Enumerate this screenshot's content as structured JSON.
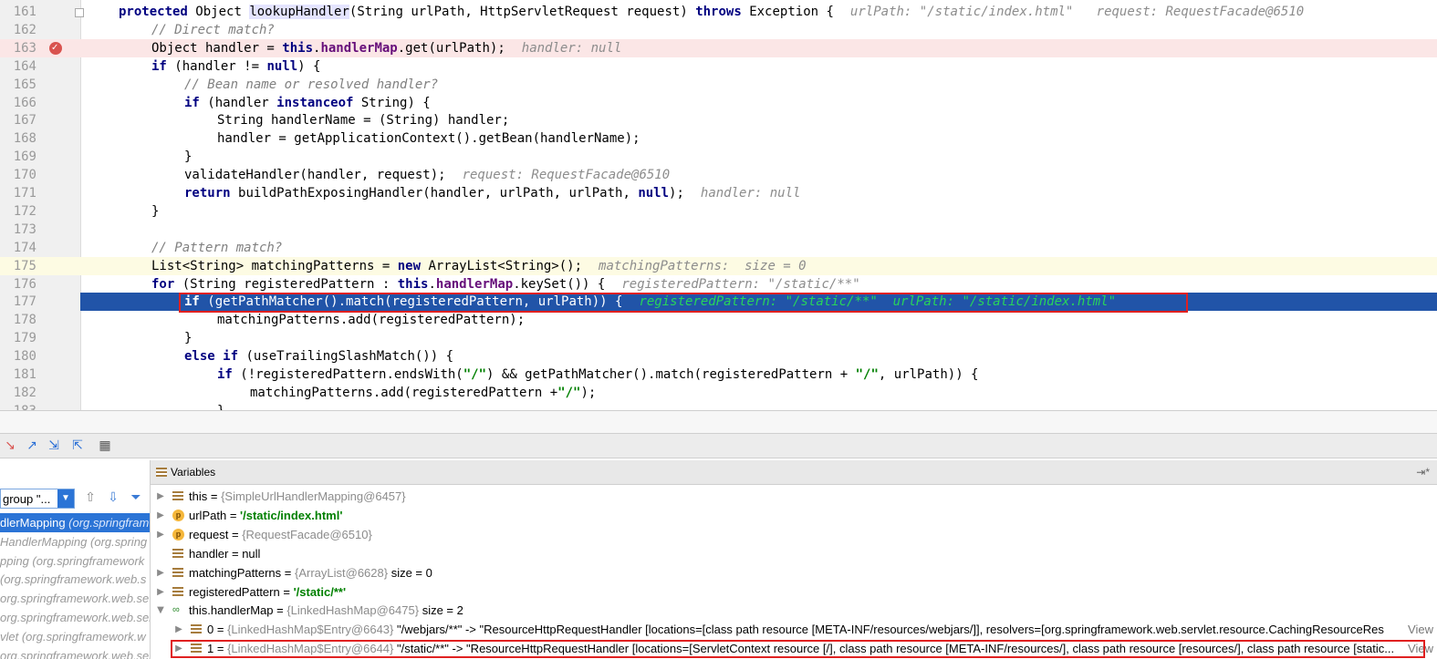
{
  "editor": {
    "lines": [
      {
        "num": "161",
        "segs": [
          [
            "kw",
            "protected "
          ],
          [
            "",
            "Object "
          ],
          [
            "hl",
            "lookupHandler"
          ],
          [
            "",
            "(String urlPath, HttpServletRequest request) "
          ],
          [
            "kw",
            "throws "
          ],
          [
            "",
            "Exception {"
          ]
        ],
        "inline": "urlPath: \"/static/index.html\"   request: RequestFacade@6510",
        "indent": 0
      },
      {
        "num": "162",
        "segs": [
          [
            "cmt",
            "// Direct match?"
          ]
        ],
        "inline": "",
        "indent": 1
      },
      {
        "num": "163",
        "segs": [
          [
            "",
            "Object handler = "
          ],
          [
            "kw",
            "this"
          ],
          [
            "",
            "."
          ],
          [
            "fld",
            "handlerMap"
          ],
          [
            "",
            ".get(urlPath);"
          ]
        ],
        "inline": "handler: null",
        "indent": 1,
        "state": "bp"
      },
      {
        "num": "164",
        "segs": [
          [
            "kw",
            "if "
          ],
          [
            "",
            "(handler != "
          ],
          [
            "kw",
            "null"
          ],
          [
            "",
            ") {"
          ]
        ],
        "inline": "",
        "indent": 1
      },
      {
        "num": "165",
        "segs": [
          [
            "cmt",
            "// Bean name or resolved handler?"
          ]
        ],
        "inline": "",
        "indent": 2
      },
      {
        "num": "166",
        "segs": [
          [
            "kw",
            "if "
          ],
          [
            "",
            "(handler "
          ],
          [
            "kw",
            "instanceof "
          ],
          [
            "",
            "String) {"
          ]
        ],
        "inline": "",
        "indent": 2
      },
      {
        "num": "167",
        "segs": [
          [
            "",
            "String handlerName = (String) handler;"
          ]
        ],
        "inline": "",
        "indent": 3
      },
      {
        "num": "168",
        "segs": [
          [
            "",
            "handler = getApplicationContext().getBean(handlerName);"
          ]
        ],
        "inline": "",
        "indent": 3
      },
      {
        "num": "169",
        "segs": [
          [
            "",
            "}"
          ]
        ],
        "inline": "",
        "indent": 2
      },
      {
        "num": "170",
        "segs": [
          [
            "",
            "validateHandler(handler, request);"
          ]
        ],
        "inline": "request: RequestFacade@6510",
        "indent": 2
      },
      {
        "num": "171",
        "segs": [
          [
            "kw",
            "return "
          ],
          [
            "",
            "buildPathExposingHandler(handler, urlPath, urlPath, "
          ],
          [
            "kw",
            "null"
          ],
          [
            "",
            ");"
          ]
        ],
        "inline": "handler: null",
        "indent": 2
      },
      {
        "num": "172",
        "segs": [
          [
            "",
            "}"
          ]
        ],
        "inline": "",
        "indent": 1
      },
      {
        "num": "173",
        "segs": [
          [
            "",
            ""
          ]
        ],
        "inline": "",
        "indent": 1
      },
      {
        "num": "174",
        "segs": [
          [
            "cmt",
            "// Pattern match?"
          ]
        ],
        "inline": "",
        "indent": 1
      },
      {
        "num": "175",
        "segs": [
          [
            "",
            "List<String> matchingPatterns = "
          ],
          [
            "kw",
            "new "
          ],
          [
            "",
            "ArrayList<String>();"
          ]
        ],
        "inline": "matchingPatterns:  size = 0",
        "indent": 1,
        "state": "caret"
      },
      {
        "num": "176",
        "segs": [
          [
            "kw",
            "for "
          ],
          [
            "",
            "(String registeredPattern : "
          ],
          [
            "kw",
            "this"
          ],
          [
            "",
            "."
          ],
          [
            "fld",
            "handlerMap"
          ],
          [
            "",
            ".keySet()) {"
          ]
        ],
        "inline": "registeredPattern: \"/static/**\"",
        "indent": 1
      },
      {
        "num": "177",
        "segs": [
          [
            "kw",
            "if "
          ],
          [
            "",
            "(getPathMatcher().match(registeredPattern, urlPath)) {"
          ]
        ],
        "inline": "registeredPattern: \"/static/**\"  urlPath: \"/static/index.html\"",
        "indent": 2,
        "state": "sel"
      },
      {
        "num": "178",
        "segs": [
          [
            "",
            "matchingPatterns.add(registeredPattern);"
          ]
        ],
        "inline": "",
        "indent": 3
      },
      {
        "num": "179",
        "segs": [
          [
            "",
            "}"
          ]
        ],
        "inline": "",
        "indent": 2
      },
      {
        "num": "180",
        "segs": [
          [
            "kw",
            "else if "
          ],
          [
            "",
            "(useTrailingSlashMatch()) {"
          ]
        ],
        "inline": "",
        "indent": 2
      },
      {
        "num": "181",
        "segs": [
          [
            "kw",
            "if "
          ],
          [
            "",
            "(!registeredPattern.endsWith("
          ],
          [
            "str",
            "\"/\""
          ],
          [
            "",
            ") && getPathMatcher().match(registeredPattern + "
          ],
          [
            "str",
            "\"/\""
          ],
          [
            "",
            ", urlPath)) {"
          ]
        ],
        "inline": "",
        "indent": 3
      },
      {
        "num": "182",
        "segs": [
          [
            "",
            "matchingPatterns.add(registeredPattern +"
          ],
          [
            "str",
            "\"/\""
          ],
          [
            "",
            ");"
          ]
        ],
        "inline": "",
        "indent": 4
      },
      {
        "num": "183",
        "segs": [
          [
            "",
            "}"
          ]
        ],
        "inline": "",
        "indent": 3
      }
    ]
  },
  "frames": {
    "thread_label": "group \"...",
    "items": [
      {
        "name": "dlerMapping",
        "pkg": " (org.springfram",
        "selected": true
      },
      {
        "name": "HandlerMapping",
        "pkg": " (org.spring",
        "selected": false
      },
      {
        "name": "pping",
        "pkg": " (org.springframework",
        "selected": false
      },
      {
        "name": "",
        "pkg": " (org.springframework.web.s",
        "selected": false
      },
      {
        "name": "",
        "pkg": "org.springframework.web.se",
        "selected": false
      },
      {
        "name": "",
        "pkg": "org.springframework.web.ser",
        "selected": false
      },
      {
        "name": "vlet",
        "pkg": " (org.springframework.w",
        "selected": false
      },
      {
        "name": "",
        "pkg": "org.springframework.web.ser",
        "selected": false
      }
    ]
  },
  "variables": {
    "title": "Variables",
    "pin": "⇥*",
    "rows": [
      {
        "tri": "▶",
        "icon": "var",
        "name": "this",
        "nameplain": true,
        "eq": " = ",
        "type": "{SimpleUrlHandlerMapping@6457}",
        "val": "",
        "strval": "",
        "level": 0
      },
      {
        "tri": "▶",
        "icon": "param",
        "name": "urlPath",
        "nameplain": true,
        "eq": " = ",
        "type": "",
        "val": "",
        "strval": "'/static/index.html'",
        "level": 0
      },
      {
        "tri": "▶",
        "icon": "param",
        "name": "request",
        "nameplain": true,
        "eq": " = ",
        "type": "{RequestFacade@6510}",
        "val": "",
        "strval": "",
        "level": 0
      },
      {
        "tri": "",
        "icon": "var",
        "name": "handler",
        "nameplain": true,
        "eq": " = ",
        "type": "",
        "val": "null",
        "strval": "",
        "level": 0
      },
      {
        "tri": "▶",
        "icon": "var",
        "name": "matchingPatterns",
        "nameplain": true,
        "eq": " = ",
        "type": "{ArrayList@6628}",
        "val": "  size = 0",
        "strval": "",
        "level": 0
      },
      {
        "tri": "▶",
        "icon": "var",
        "name": "registeredPattern",
        "nameplain": true,
        "eq": " = ",
        "type": "",
        "val": "",
        "strval": "'/static/**'",
        "level": 0
      },
      {
        "tri": "▼",
        "icon": "field",
        "name": "this.handlerMap",
        "nameplain": true,
        "eq": " = ",
        "type": "{LinkedHashMap@6475}",
        "val": "  size = 2",
        "strval": "",
        "level": 0
      },
      {
        "tri": "▶",
        "icon": "var",
        "name": "0",
        "nameplain": true,
        "eq": " = ",
        "type": "{LinkedHashMap$Entry@6643}",
        "val": " \"/webjars/**\" -> \"ResourceHttpRequestHandler [locations=[class path resource [META-INF/resources/webjars/]], resolvers=[org.springframework.web.servlet.resource.CachingResourceRes",
        "strval": "",
        "level": 1,
        "view": "View"
      },
      {
        "tri": "▶",
        "icon": "var",
        "name": "1",
        "nameplain": true,
        "eq": " = ",
        "type": "{LinkedHashMap$Entry@6644}",
        "val": " \"/static/**\" -> \"ResourceHttpRequestHandler [locations=[ServletContext resource [/], class path resource [META-INF/resources/], class path resource [resources/], class path resource [static...",
        "strval": "",
        "level": 1,
        "view": "View"
      }
    ]
  },
  "colors": {
    "selection": "#2154a8",
    "breakpoint": "#fbe6e6",
    "redbox": "#e02020"
  }
}
